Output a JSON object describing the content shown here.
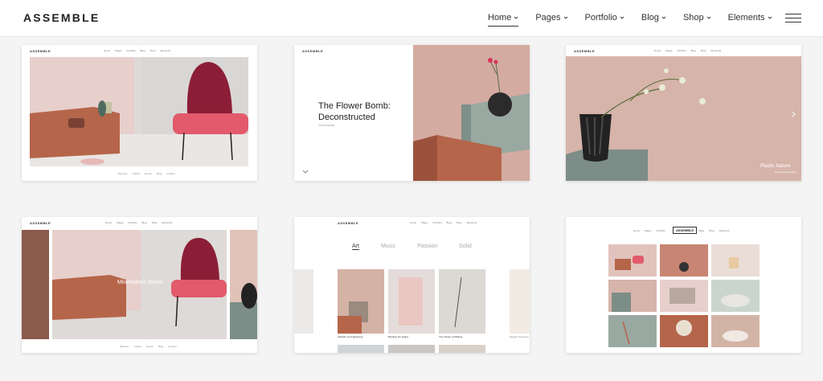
{
  "header": {
    "brand": "ASSEMBLE",
    "nav": [
      "Home",
      "Pages",
      "Portfolio",
      "Blog",
      "Shop",
      "Elements"
    ]
  },
  "mini": {
    "brand": "ASSEMBLE",
    "nav": [
      "Home",
      "Pages",
      "Portfolio",
      "Blog",
      "Shop",
      "Elements"
    ],
    "foot": [
      "Discover",
      "Collect",
      "Interior",
      "Blog",
      "Contact"
    ]
  },
  "card2": {
    "title_line1": "The Flower Bomb:",
    "title_line2": "Deconstructed",
    "sub": "Conceptual"
  },
  "card3": {
    "caption": "Plastic Nature",
    "sub": "Design Photography"
  },
  "card4": {
    "caption": "Minimalistic Room"
  },
  "card5": {
    "tabs": [
      "Art",
      "Music",
      "Passion",
      "Solid"
    ],
    "captions": [
      "Solitude and Happiness",
      "Bending the Space",
      "The Artistry of Waiting",
      "Elegant Shopping"
    ]
  },
  "colors": {
    "accent": "#222222",
    "terracotta": "#b5654a",
    "pink": "#e7cfcc",
    "chair": "#e25a6b",
    "sage": "#9aa8a2"
  }
}
